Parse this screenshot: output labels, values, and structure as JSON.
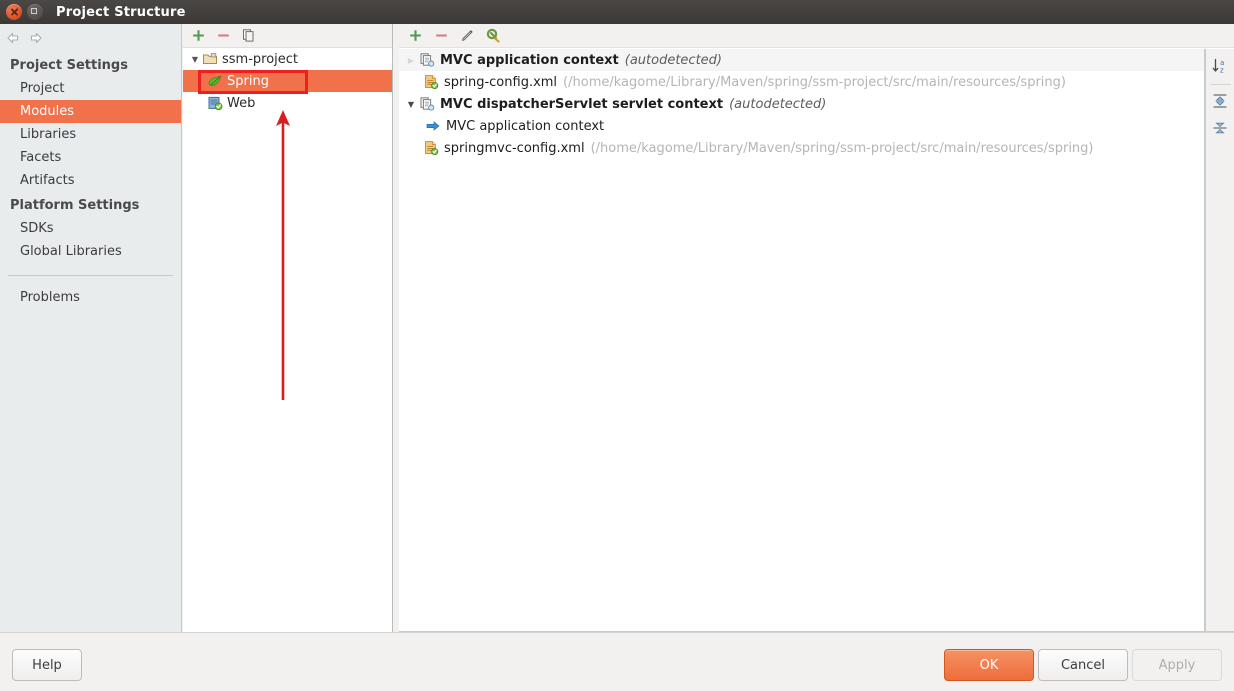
{
  "window": {
    "title": "Project Structure",
    "close_icon": "close-icon",
    "maximize_icon": "maximize-icon"
  },
  "sidebar": {
    "nav": {
      "back_icon": "arrow-left-icon",
      "forward_icon": "arrow-right-icon"
    },
    "groups": [
      {
        "title": "Project Settings",
        "items": [
          {
            "label": "Project",
            "selected": false
          },
          {
            "label": "Modules",
            "selected": true
          },
          {
            "label": "Libraries",
            "selected": false
          },
          {
            "label": "Facets",
            "selected": false
          },
          {
            "label": "Artifacts",
            "selected": false
          }
        ]
      },
      {
        "title": "Platform Settings",
        "items": [
          {
            "label": "SDKs",
            "selected": false
          },
          {
            "label": "Global Libraries",
            "selected": false
          }
        ]
      }
    ],
    "problems_label": "Problems"
  },
  "modules_panel": {
    "toolbar": [
      {
        "name": "add-module-button",
        "icon": "plus-icon"
      },
      {
        "name": "remove-module-button",
        "icon": "minus-icon"
      },
      {
        "name": "copy-module-button",
        "icon": "copy-icon"
      }
    ],
    "tree": [
      {
        "label": "ssm-project",
        "icon": "folder-icon",
        "level": 0,
        "expanded": true,
        "selected": false
      },
      {
        "label": "Spring",
        "icon": "spring-leaf-icon",
        "level": 1,
        "expanded": null,
        "selected": true
      },
      {
        "label": "Web",
        "icon": "web-module-icon",
        "level": 1,
        "expanded": null,
        "selected": false
      }
    ]
  },
  "detail_panel": {
    "toolbar": [
      {
        "name": "add-context-button",
        "icon": "plus-icon"
      },
      {
        "name": "remove-context-button",
        "icon": "minus-icon"
      },
      {
        "name": "edit-context-button",
        "icon": "pencil-icon"
      },
      {
        "name": "configure-button",
        "icon": "wrench-icon"
      }
    ],
    "rows": [
      {
        "kind": "context",
        "twisty": "collapsed-faded",
        "icon": "application-context-icon",
        "title": "MVC application context",
        "suffix": "(autodetected)",
        "path": "",
        "indent": 0,
        "highlighted": true
      },
      {
        "kind": "file",
        "twisty": "",
        "icon": "xml-file-icon",
        "title": "spring-config.xml",
        "suffix": "",
        "path": "(/home/kagome/Library/Maven/spring/ssm-project/src/main/resources/spring)",
        "indent": 1,
        "highlighted": false
      },
      {
        "kind": "context",
        "twisty": "expanded",
        "icon": "application-context-icon",
        "title": "MVC dispatcherServlet servlet context",
        "suffix": "(autodetected)",
        "path": "",
        "indent": 0,
        "highlighted": false
      },
      {
        "kind": "ref",
        "twisty": "",
        "icon": "blue-arrow-icon",
        "title": "MVC application context",
        "suffix": "",
        "path": "",
        "indent": 1,
        "highlighted": false
      },
      {
        "kind": "file",
        "twisty": "",
        "icon": "xml-file-icon",
        "title": "springmvc-config.xml",
        "suffix": "",
        "path": "(/home/kagome/Library/Maven/spring/ssm-project/src/main/resources/spring)",
        "indent": 1,
        "highlighted": false
      }
    ],
    "side_buttons": [
      {
        "name": "sort-alphabetically-button",
        "icon": "sort-az-icon"
      },
      {
        "name": "expand-all-button",
        "icon": "expand-all-icon"
      },
      {
        "name": "collapse-all-button",
        "icon": "collapse-all-icon"
      }
    ]
  },
  "footer": {
    "help_label": "Help",
    "ok_label": "OK",
    "cancel_label": "Cancel",
    "apply_label": "Apply"
  },
  "annotations": {
    "highlight_rect_color": "#ef1f1f",
    "arrow_color": "#d81f1f",
    "arrow_name": "red-up-arrow-annotation",
    "rect_name": "red-highlight-rect-annotation"
  },
  "colors": {
    "accent_orange": "#f0714a",
    "ok_button_orange": "#ee6d3c",
    "titlebar": "#3b3836",
    "sidebar_bg": "#e9eced",
    "path_gray": "#b5b5b5"
  }
}
